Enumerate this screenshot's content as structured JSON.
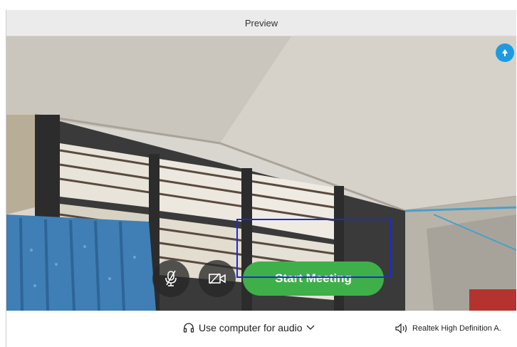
{
  "window": {
    "title": "Preview"
  },
  "controls": {
    "mute_icon": "microphone-muted-icon",
    "video_icon": "video-off-icon",
    "start_label": "Start Meeting",
    "corner_icon": "pin-icon"
  },
  "footer": {
    "audio_label": "Use computer for audio",
    "audio_icon": "headset-icon",
    "speaker_label": "Realtek High Definition A.",
    "speaker_icon": "speaker-icon"
  },
  "colors": {
    "accent_green": "#3faf4a",
    "focus_outline": "#1a2bd6",
    "info_blue": "#1e9be0"
  }
}
